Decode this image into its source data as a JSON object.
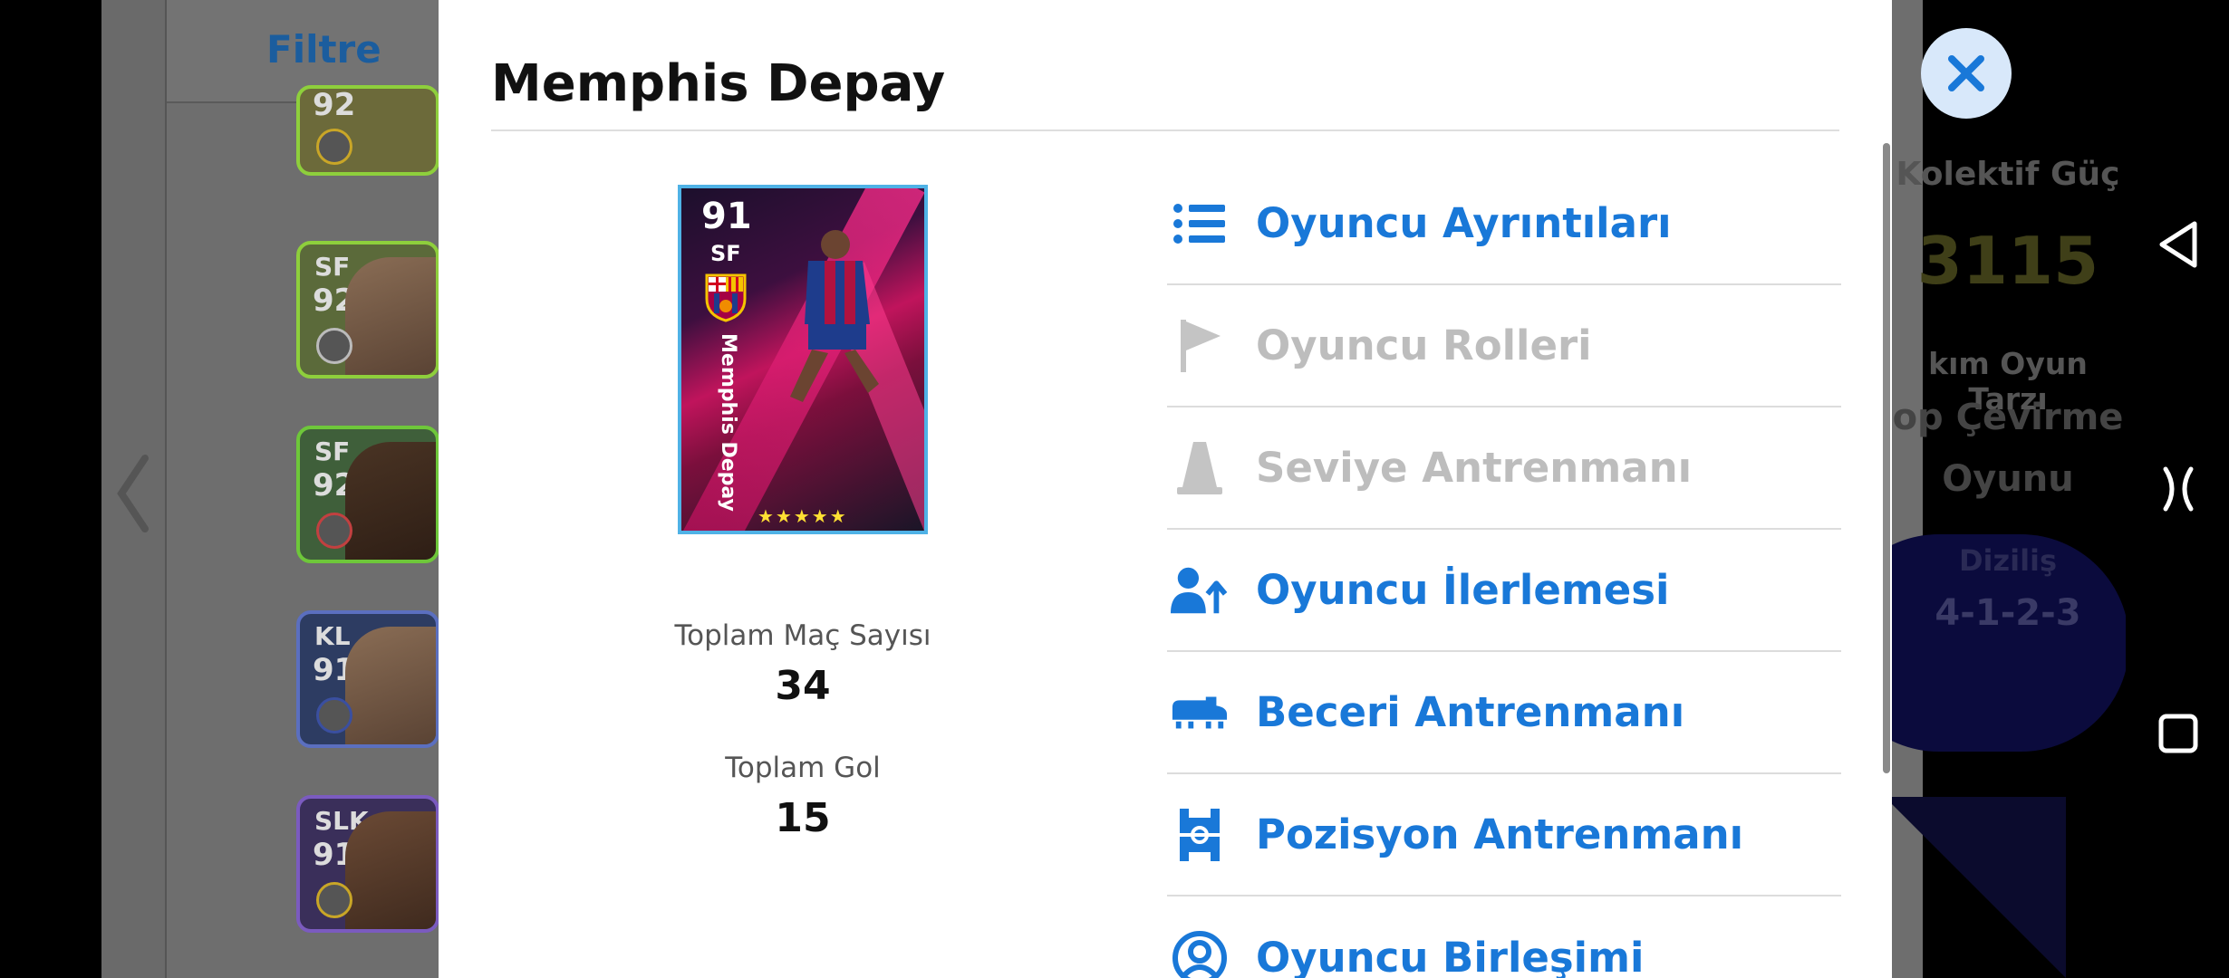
{
  "background": {
    "filter_label": "Filtre",
    "cards": [
      {
        "pos": "",
        "rating": "92",
        "border": "#8ecf3c",
        "bg": "#6e6e3c"
      },
      {
        "pos": "SF",
        "rating": "92",
        "border": "#8ecf3c",
        "bg": "#5b6a3a"
      },
      {
        "pos": "SF",
        "rating": "92",
        "border": "#6ec73a",
        "bg": "#3f5f3a"
      },
      {
        "pos": "KL",
        "rating": "91",
        "border": "#5b6fbf",
        "bg": "#2d3c62"
      },
      {
        "pos": "SLK",
        "rating": "91",
        "border": "#7b5bbf",
        "bg": "#3a2f5a"
      }
    ],
    "right_panel": {
      "collective_power_label": "Kolektif Güç",
      "collective_power_value": "3115",
      "team_style_label": "kım Oyun Tarzı",
      "team_style_value_1": "op Çevirme",
      "team_style_value_2": "Oyunu",
      "formation_label": "Diziliş",
      "formation_value": "4-1-2-3"
    }
  },
  "modal": {
    "title": "Memphis Depay",
    "card": {
      "rating": "91",
      "position": "SF",
      "vertical_name": "Memphis Depay",
      "stars": "★★★★★",
      "accent": "#4fb2e6"
    },
    "stats": [
      {
        "label": "Toplam Maç Sayısı",
        "value": "34"
      },
      {
        "label": "Toplam Gol",
        "value": "15"
      }
    ],
    "menu": [
      {
        "label": "Oyuncu Ayrıntıları",
        "icon": "list-icon",
        "enabled": true
      },
      {
        "label": "Oyuncu Rolleri",
        "icon": "flag-icon",
        "enabled": false
      },
      {
        "label": "Seviye Antrenmanı",
        "icon": "cone-icon",
        "enabled": false
      },
      {
        "label": "Oyuncu İlerlemesi",
        "icon": "person-up-icon",
        "enabled": true
      },
      {
        "label": "Beceri Antrenmanı",
        "icon": "boot-icon",
        "enabled": true
      },
      {
        "label": "Pozisyon Antrenmanı",
        "icon": "pitch-icon",
        "enabled": true
      },
      {
        "label": "Oyuncu Birleşimi",
        "icon": "user-circle-icon",
        "enabled": true
      }
    ],
    "colors": {
      "accent": "#1978d8",
      "disabled": "#bdbdbd"
    }
  }
}
